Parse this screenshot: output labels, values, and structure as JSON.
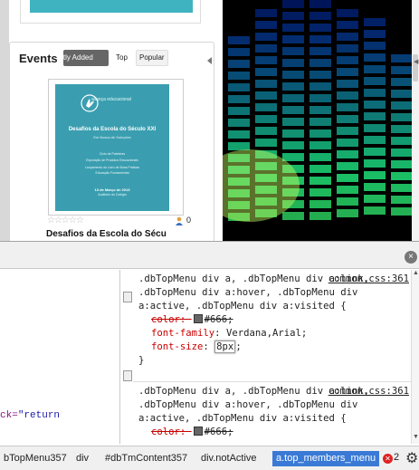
{
  "site": {
    "events": {
      "title": "Events",
      "tabs": [
        "ently Added",
        "Top",
        "Popular"
      ],
      "event": {
        "poster": {
          "org": "aliança educacional",
          "title": "Desafios da Escola do Século XXI",
          "subtitle": "Em Busca de Soluções",
          "lines": [
            "Ciclo de Palestras",
            "Exposição de Produtos Educacionais",
            "Lançamento do Livro de Boas Práticas",
            "Educação Fundamental"
          ],
          "date": "13 de Março de 2013",
          "place": "Auditório do Colégio"
        },
        "stars": "☆☆☆☆☆",
        "attendees": "0",
        "name": "Desafios da Escola do Sécu"
      }
    },
    "colors": {
      "teal": "#3fb3bf",
      "devtools_active": "#3a7ad6"
    }
  },
  "devtools": {
    "close_label": "×",
    "dom_line_prefix": "ck=",
    "dom_line_value": "\"return",
    "rules": [
      {
        "selector": ".dbTopMenu div a, .dbTopMenu div a:link, .dbTopMenu div a:hover, .dbTopMenu div a:active, .dbTopMenu div a:visited {",
        "source": "common.css:361",
        "declarations": [
          {
            "prop": "color",
            "value": "#666",
            "struck": true,
            "swatch": "#666666"
          },
          {
            "prop": "font-family",
            "value": "Verdana,Arial",
            "struck": false
          },
          {
            "prop": "font-size",
            "value": "8px",
            "struck": false,
            "editing": true
          }
        ],
        "close": "}"
      },
      {
        "selector": ".dbTopMenu div a, .dbTopMenu div a:link, .dbTopMenu div a:hover, .dbTopMenu div a:active, .dbTopMenu div a:visited {",
        "source": "common.css:361",
        "declarations": [
          {
            "prop": "color",
            "value": "#666",
            "struck": true,
            "swatch": "#666666"
          }
        ]
      }
    ],
    "breadcrumbs": [
      "bTopMenu357",
      "div",
      "#dbTmContent357",
      "div.notActive",
      "a.top_members_menu"
    ],
    "error_count": "2"
  }
}
